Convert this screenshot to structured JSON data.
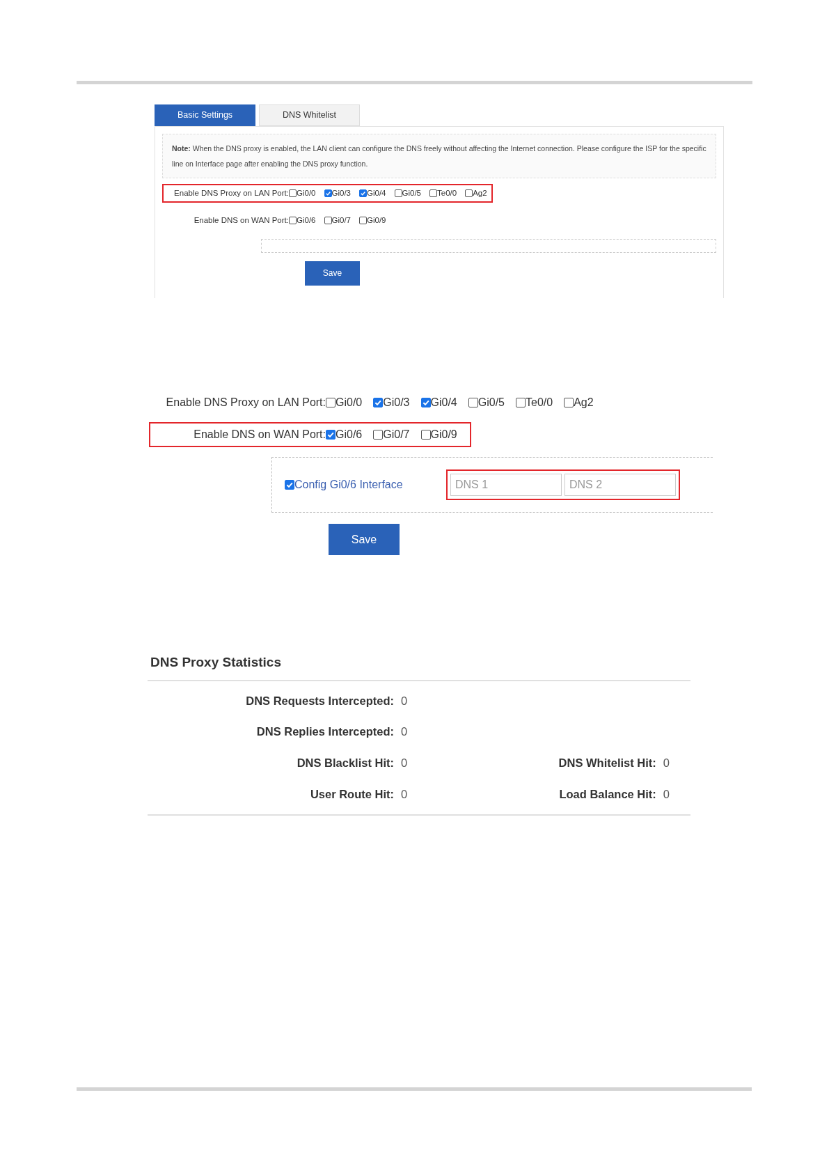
{
  "panel_1": {
    "tabs": [
      {
        "label": "Basic Settings",
        "selected": true
      },
      {
        "label": "DNS Whitelist",
        "selected": false
      }
    ],
    "note": "**Note:** When the DNS proxy is enabled, the LAN client can configure the DNS freely without affecting the Internet connection. Please configure the ISP for the specific line on Interface page after enabling the DNS proxy function.",
    "port_rows": [
      {
        "label": "Enable DNS Proxy on LAN Port:",
        "highlighted": true,
        "ports": [
          {
            "label": "Gi0/0",
            "checked": false
          },
          {
            "label": "Gi0/3",
            "checked": true
          },
          {
            "label": "Gi0/4",
            "checked": true
          },
          {
            "label": "Gi0/5",
            "checked": false
          },
          {
            "label": "Te0/0",
            "checked": false
          },
          {
            "label": "Ag2",
            "checked": false
          }
        ]
      },
      {
        "label": "Enable DNS on WAN Port:",
        "highlighted": false,
        "ports": [
          {
            "label": "Gi0/6",
            "checked": false
          },
          {
            "label": "Gi0/7",
            "checked": false
          },
          {
            "label": "Gi0/9",
            "checked": false
          }
        ]
      }
    ],
    "save": "Save"
  },
  "panel_2": {
    "port_rows": [
      {
        "label": "Enable DNS Proxy on LAN Port:",
        "highlighted": false,
        "ports": [
          {
            "label": "Gi0/0",
            "checked": false
          },
          {
            "label": "Gi0/3",
            "checked": true
          },
          {
            "label": "Gi0/4",
            "checked": true
          },
          {
            "label": "Gi0/5",
            "checked": false
          },
          {
            "label": "Te0/0",
            "checked": false
          },
          {
            "label": "Ag2",
            "checked": false
          }
        ]
      },
      {
        "label": "Enable DNS on WAN Port:",
        "highlighted": true,
        "ports": [
          {
            "label": "Gi0/6",
            "checked": true
          },
          {
            "label": "Gi0/7",
            "checked": false
          },
          {
            "label": "Gi0/9",
            "checked": false
          }
        ]
      }
    ],
    "interface_config": {
      "label": "Config Gi0/6 Interface",
      "checked": true,
      "highlighted": true,
      "fields": [
        {
          "placeholder": "DNS 1"
        },
        {
          "placeholder": "DNS 2"
        }
      ]
    },
    "save": "Save"
  },
  "statistics": {
    "title": "DNS Proxy Statistics",
    "rows": [
      [
        {
          "label": "DNS Requests Intercepted:",
          "value": "0"
        }
      ],
      [
        {
          "label": "DNS Replies Intercepted:",
          "value": "0"
        }
      ],
      [
        {
          "label": "DNS Blacklist Hit:",
          "value": "0"
        },
        {
          "label": "DNS Whitelist Hit:",
          "value": "0"
        }
      ],
      [
        {
          "label": "User Route Hit:",
          "value": "0"
        },
        {
          "label": "Load Balance Hit:",
          "value": "0"
        }
      ]
    ]
  }
}
